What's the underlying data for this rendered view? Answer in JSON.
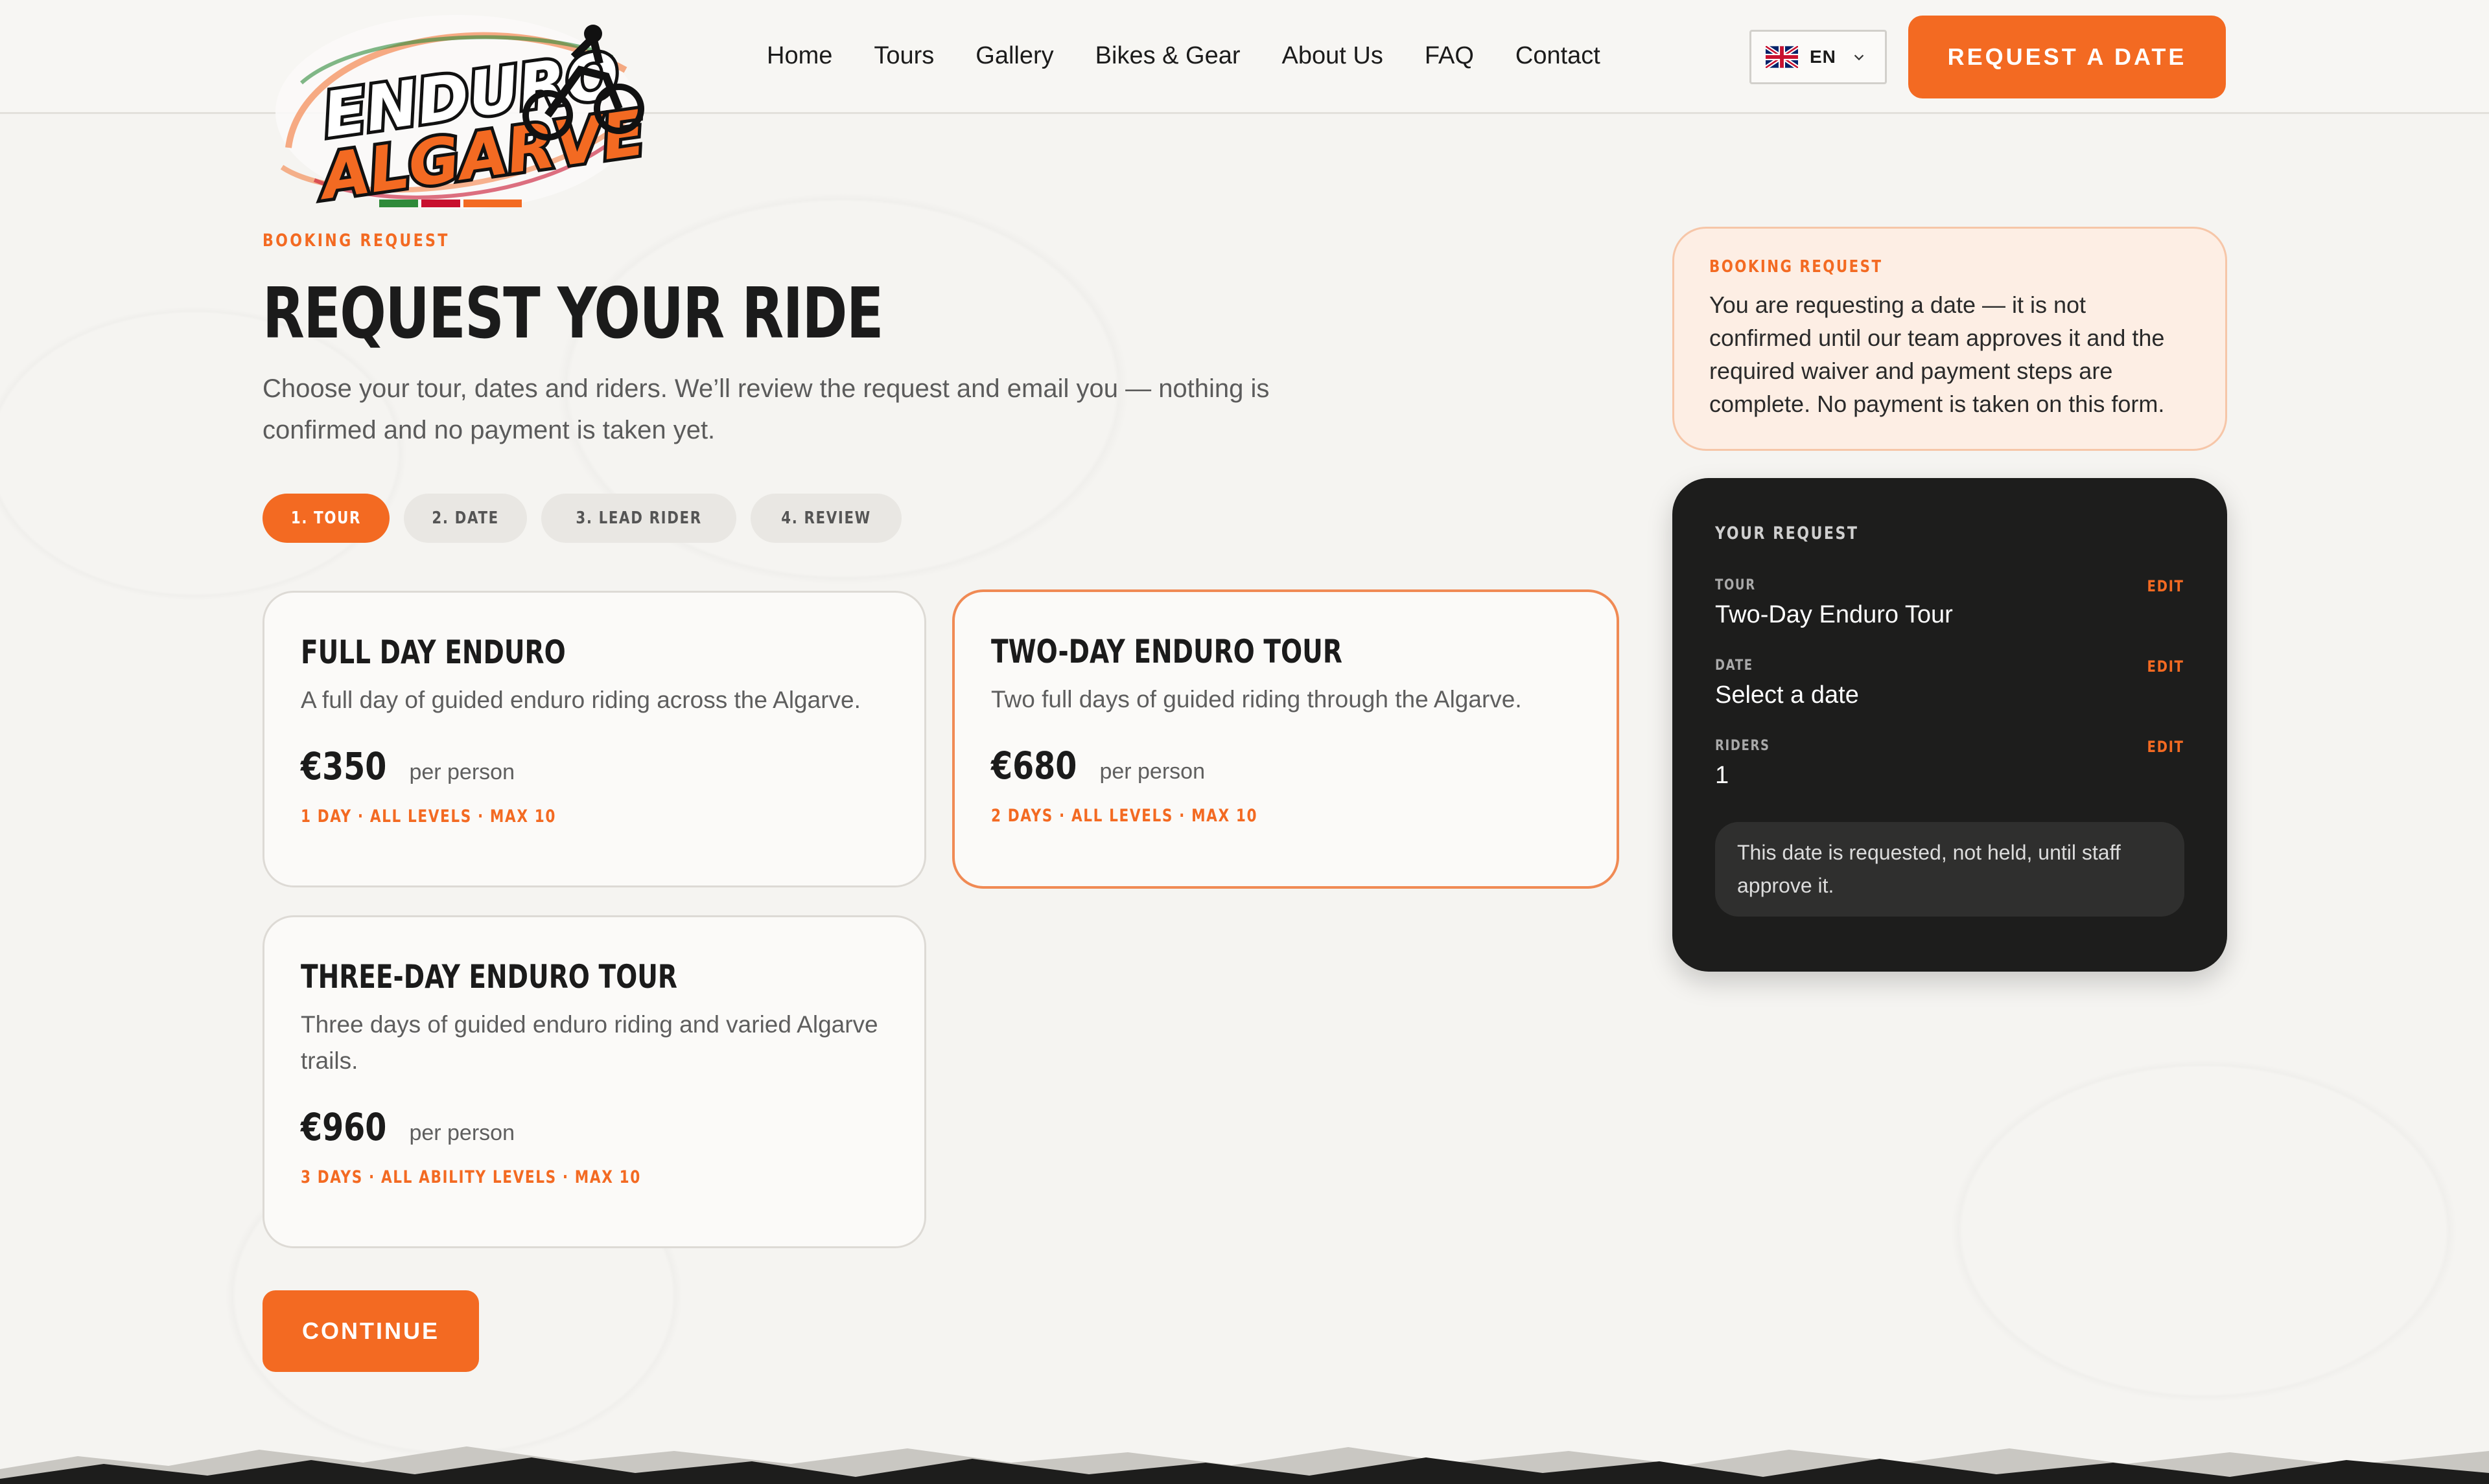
{
  "header": {
    "logo_text_top": "ENDURO",
    "logo_text_bottom": "ALGARVE",
    "nav": [
      "Home",
      "Tours",
      "Gallery",
      "Bikes & Gear",
      "About Us",
      "FAQ",
      "Contact"
    ],
    "language": "EN",
    "cta_label": "REQUEST A DATE"
  },
  "main": {
    "eyebrow": "BOOKING REQUEST",
    "title": "REQUEST YOUR RIDE",
    "intro": "Choose your tour, dates and riders. We’ll review the request and email you — nothing is confirmed and no payment is taken yet.",
    "steps": [
      {
        "label": "1. TOUR",
        "active": true
      },
      {
        "label": "2. DATE",
        "active": false
      },
      {
        "label": "3. LEAD RIDER",
        "active": false
      },
      {
        "label": "4. REVIEW",
        "active": false
      }
    ],
    "tours": [
      {
        "title": "FULL DAY ENDURO",
        "description": "A full day of guided enduro riding across the Algarve.",
        "price": "€350",
        "per": "per person",
        "meta": "1 DAY · ALL LEVELS · MAX 10"
      },
      {
        "title": "TWO-DAY ENDURO TOUR",
        "description": "Two full days of guided riding through the Algarve.",
        "price": "€680",
        "per": "per person",
        "meta": "2 DAYS · ALL LEVELS · MAX 10"
      },
      {
        "title": "THREE-DAY ENDURO TOUR",
        "description": "Three days of guided enduro riding and varied Algarve trails.",
        "price": "€960",
        "per": "per person",
        "meta": "3 DAYS · ALL ABILITY LEVELS · MAX 10"
      }
    ],
    "continue_label": "CONTINUE"
  },
  "notice": {
    "eyebrow": "BOOKING REQUEST",
    "text": "You are requesting a date — it is not confirmed until our team approves it and the required waiver and payment steps are complete. No payment is taken on this form."
  },
  "summary": {
    "eyebrow": "YOUR REQUEST",
    "edit_label": "EDIT",
    "rows": [
      {
        "label": "TOUR",
        "value": "Two-Day Enduro Tour"
      },
      {
        "label": "DATE",
        "value": "Select a date"
      },
      {
        "label": "RIDERS",
        "value": "1"
      }
    ],
    "note": "This date is requested, not held, until staff approve it."
  },
  "colors": {
    "accent": "#f36a22",
    "background": "#f5f4f1",
    "dark_panel": "#1d1d1c",
    "notice_bg": "#fdeee4"
  }
}
